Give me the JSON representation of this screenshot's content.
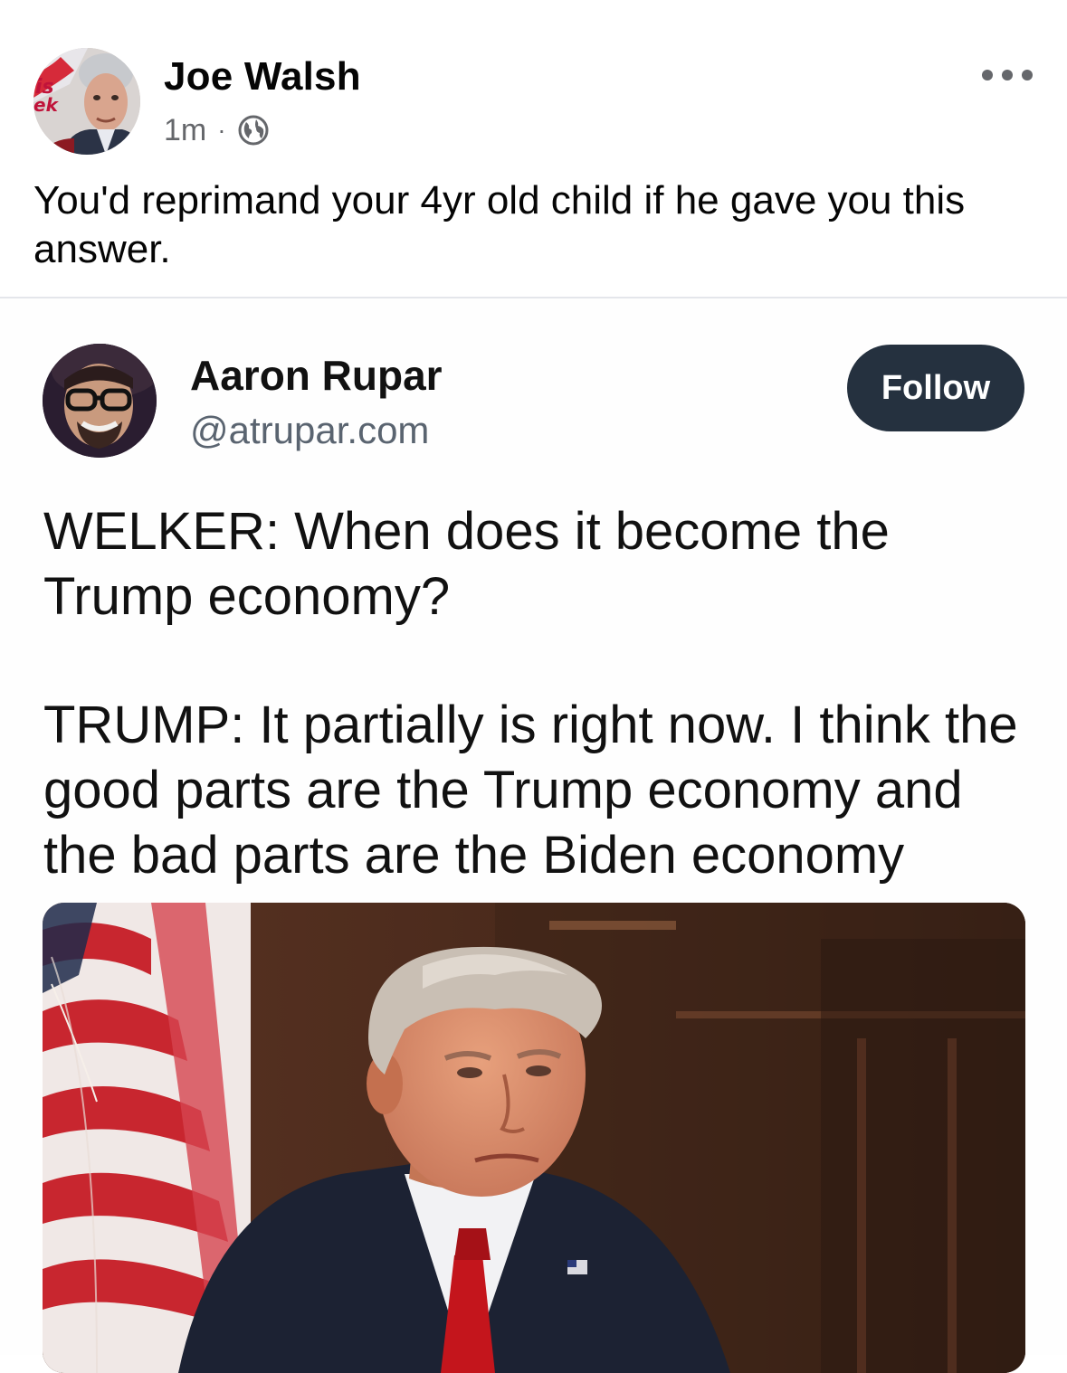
{
  "post": {
    "author": "Joe Walsh",
    "time": "1m",
    "separator": "·",
    "privacy_icon": "globe-icon",
    "more_icon": "more-options-icon",
    "text": "You'd reprimand your 4yr old child if he gave you this answer."
  },
  "embed": {
    "author": "Aaron Rupar",
    "handle": "@atrupar.com",
    "follow_label": "Follow",
    "paragraph_1": "WELKER: When does it become the Trump economy?",
    "paragraph_2": "TRUMP: It partially is right now. I think the good parts are the Trump economy and the bad parts are the Biden economy"
  },
  "colors": {
    "follow_bg": "#25313f",
    "meta_gray": "#65676b"
  }
}
